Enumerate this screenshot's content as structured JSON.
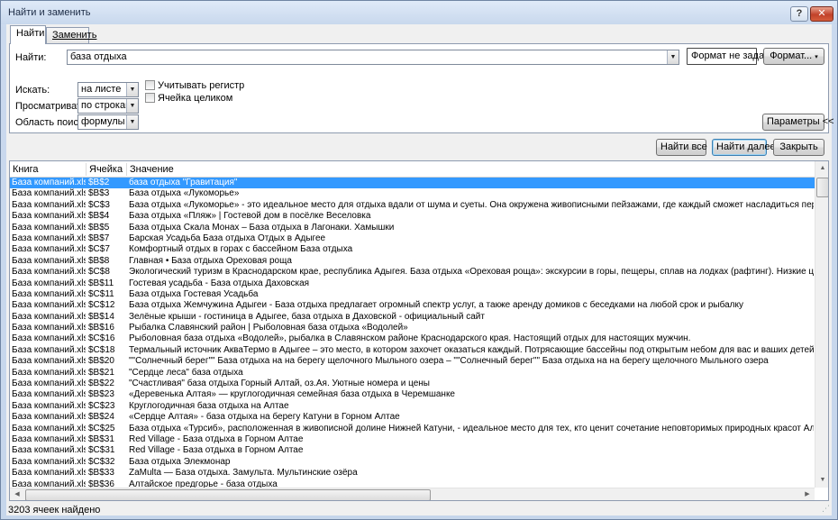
{
  "window": {
    "title": "Найти и заменить",
    "help_label": "?",
    "close_label": "✕"
  },
  "tabs": [
    {
      "label": "Найти"
    },
    {
      "label": "Заменить"
    }
  ],
  "find": {
    "label": "Найти:",
    "value": "база отдыха",
    "format_status": "Формат не задан",
    "format_button": "Формат..."
  },
  "options": {
    "within_label": "Искать:",
    "within_value": "на листе",
    "search_label": "Просматривать:",
    "search_value": "по строкам",
    "lookin_label": "Область поиска:",
    "lookin_value": "формулы",
    "match_case_label": "Учитывать регистр",
    "match_case_checked": false,
    "entire_cell_label": "Ячейка целиком",
    "entire_cell_checked": false,
    "params_button": "Параметры <<"
  },
  "actions": {
    "find_all": "Найти все",
    "find_next": "Найти далее",
    "close": "Закрыть"
  },
  "results": {
    "columns": [
      "Книга",
      "Ячейка",
      "Значение"
    ],
    "rows": [
      [
        "База компаний.xlsx",
        "$B$2",
        "база отдыха \"Гравитация\""
      ],
      [
        "База компаний.xlsx",
        "$B$3",
        "База отдыха «Лукоморье»"
      ],
      [
        "База компаний.xlsx",
        "$C$3",
        "База отдыха «Лукоморье» - это идеальное место для отдыха вдали от шума и суеты. Она окружена живописными пейзажами, где каждый сможет насладиться первозданной природой. К услугам гостей п"
      ],
      [
        "База компаний.xlsx",
        "$B$4",
        "База отдыха «Пляж» | Гостевой дом в посёлке Веселовка"
      ],
      [
        "База компаний.xlsx",
        "$B$5",
        "База отдыха Скала Монах – База отдыха в Лагонаки. Хамышки"
      ],
      [
        "База компаний.xlsx",
        "$B$7",
        "Барская Усадьба База отдыха Отдых в Адыгее"
      ],
      [
        "База компаний.xlsx",
        "$C$7",
        "Комфортный отдых в горах с бассейном База отдыха"
      ],
      [
        "База компаний.xlsx",
        "$B$8",
        "Главная • База отдыха Ореховая роща"
      ],
      [
        "База компаний.xlsx",
        "$C$8",
        "Экологический туризм в Краснодарском крае, республика Адыгея. База отдыха «Ореховая роща»: экскурсии в горы, пещеры, сплав на лодках (рафтинг). Низкие цены, отличные условия."
      ],
      [
        "База компаний.xlsx",
        "$B$11",
        "Гостевая усадьба - База отдыха Даховская"
      ],
      [
        "База компаний.xlsx",
        "$C$11",
        "База отдыха Гостевая Усадьба"
      ],
      [
        "База компаний.xlsx",
        "$C$12",
        "База отдыха Жемчужина Адыгеи - База отдыха предлагает огромный спектр услуг, а также аренду домиков с беседками на любой срок и рыбалку"
      ],
      [
        "База компаний.xlsx",
        "$B$14",
        "Зелёные крыши - гостиница в Адыгее, база отдыха в Даховской - официальный сайт"
      ],
      [
        "База компаний.xlsx",
        "$B$16",
        "Рыбалка Славянский район | Рыболовная база отдыха «Водолей»"
      ],
      [
        "База компаний.xlsx",
        "$C$16",
        "Рыболовная база отдыха «Водолей», рыбалка в Славянском районе Краснодарского края. Настоящий отдых для настоящих мужчин."
      ],
      [
        "База компаний.xlsx",
        "$C$18",
        "Термальный источник АкваТермо в Адыгее – это место, в котором захочет оказаться каждый. Потрясающие бассейны под открытым небом для вас и ваших детей. Три термальных бассейна, два из которых"
      ],
      [
        "База компаний.xlsx",
        "$B$20",
        "\"\"Солнечный берег\"\" База отдыха на на берегу щелочного Мыльного озера – \"\"Солнечный берег\"\" База отдыха на на берегу щелочного Мыльного озера"
      ],
      [
        "База компаний.xlsx",
        "$B$21",
        "\"Сердце леса\" база отдыха"
      ],
      [
        "База компаний.xlsx",
        "$B$22",
        "\"Счастливая\" база отдыха Горный Алтай, оз.Ая. Уютные номера и цены"
      ],
      [
        "База компаний.xlsx",
        "$B$23",
        "«Деревенька Алтая» — круглогодичная семейная база отдыха в Черемшанке"
      ],
      [
        "База компаний.xlsx",
        "$C$23",
        "Круглогодичная база отдыха на Алтае"
      ],
      [
        "База компаний.xlsx",
        "$B$24",
        "«Сердце Алтая» - база отдыха на берегу Катуни в Горном Алтае"
      ],
      [
        "База компаний.xlsx",
        "$C$25",
        "База отдыха «Турсиб», расположенная в живописной долине Нижней Катуни, - идеальное место для тех, кто ценит сочетание неповторимых природных красот Алтая с комфортом и качественным сервисом"
      ],
      [
        "База компаний.xlsx",
        "$B$31",
        "Red Village - База отдыха в Горном Алтае"
      ],
      [
        "База компаний.xlsx",
        "$C$31",
        "Red Village - База отдыха в Горном Алтае"
      ],
      [
        "База компаний.xlsx",
        "$C$32",
        "База отдыха Элекмонар"
      ],
      [
        "База компаний.xlsx",
        "$B$33",
        "ZaMulta — База отдыха. Замульта. Мультинские озёра"
      ],
      [
        "База компаний.xlsx",
        "$B$36",
        "Алтайское предгорье - база отдыха"
      ]
    ]
  },
  "status": "3203 ячеек найдено",
  "icons": {
    "dropdown": "dropdown-arrow-icon",
    "scroll_up": "scroll-up-icon",
    "scroll_down": "scroll-down-icon",
    "scroll_left": "scroll-left-icon",
    "scroll_right": "scroll-right-icon"
  }
}
